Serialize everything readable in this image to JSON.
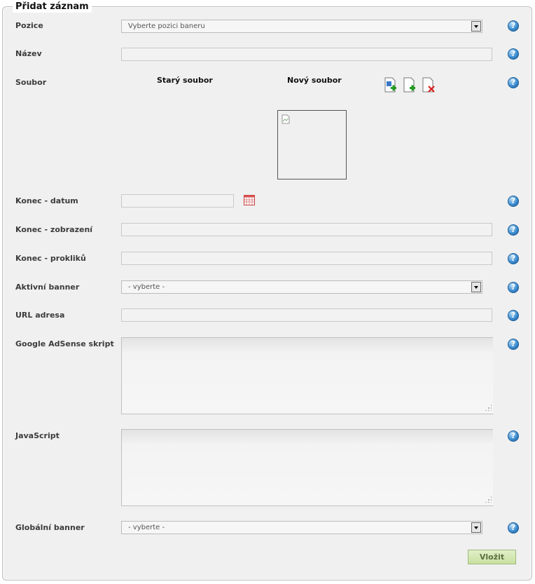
{
  "form": {
    "title": "Přidat záznam",
    "submit_label": "Vložit"
  },
  "fields": {
    "pozice": {
      "label": "Pozice",
      "value": "Vyberte pozici baneru"
    },
    "nazev": {
      "label": "Název",
      "value": ""
    },
    "soubor": {
      "label": "Soubor",
      "old_file_header": "Starý soubor",
      "new_file_header": "Nový soubor"
    },
    "konec_datum": {
      "label": "Konec - datum",
      "value": ""
    },
    "konec_zobrazeni": {
      "label": "Konec - zobrazení",
      "value": ""
    },
    "konec_prokliku": {
      "label": "Konec - prokliků",
      "value": ""
    },
    "aktivni_banner": {
      "label": "Aktivní banner",
      "value": "- vyberte -"
    },
    "url_adresa": {
      "label": "URL adresa",
      "value": ""
    },
    "adsense": {
      "label": "Google AdSense skript",
      "value": ""
    },
    "javascript": {
      "label": "JavaScript",
      "value": ""
    },
    "globalni_banner": {
      "label": "Globální banner",
      "value": "- vyberte -"
    }
  },
  "help_icon_glyph": "?",
  "icons": {
    "help": "help-icon",
    "calendar": "calendar-icon",
    "file_add_image": "add-image-file-icon",
    "file_add": "add-file-icon",
    "file_delete": "delete-file-icon",
    "image_placeholder": "broken-image-icon"
  },
  "colors": {
    "panel_bg": "#f0f0f0",
    "help_blue": "#3f8fd2",
    "submit_green": "#c8e0a0"
  }
}
